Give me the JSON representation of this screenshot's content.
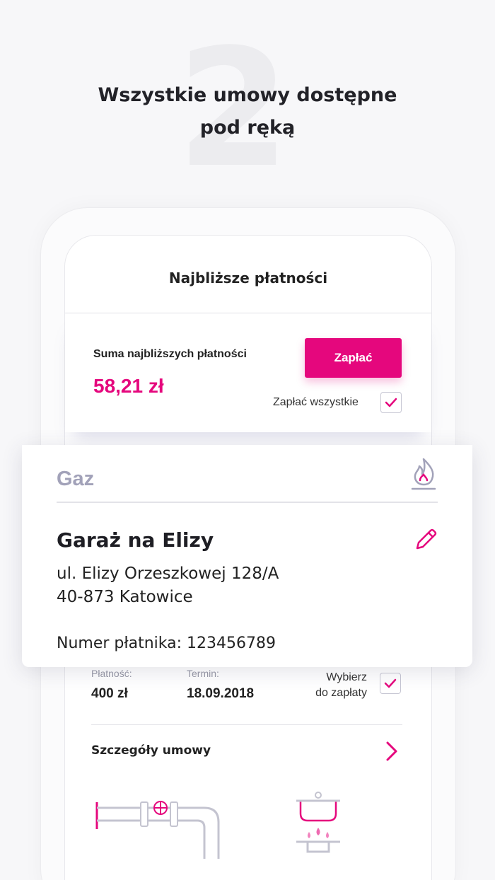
{
  "intro": {
    "step_number": "2",
    "headline_line1": "Wszystkie umowy dostępne",
    "headline_line2": "pod ręką"
  },
  "screen": {
    "title": "Najbliższe płatności"
  },
  "summary": {
    "label": "Suma najbliższych płatności",
    "amount": "58,21 zł",
    "pay_button": "Zapłać",
    "pay_all_label": "Zapłać wszystkie",
    "pay_all_checked": true
  },
  "contract": {
    "type": "Gaz",
    "name": "Garaż na Elizy",
    "address_line1": "ul. Elizy Orzeszkowej 128/A",
    "address_line2": "40-873 Katowice",
    "payer_number": "Numer płatnika: 123456789"
  },
  "payment": {
    "amount_label": "Płatność:",
    "amount": "400 zł",
    "term_label": "Termin:",
    "term": "18.09.2018",
    "choose_line1": "Wybierz",
    "choose_line2": "do zapłaty",
    "choose_checked": true,
    "details_link": "Szczegóły umowy"
  },
  "colors": {
    "accent": "#e5077d",
    "muted_title": "#a2a2b9",
    "background": "#f7f7f9"
  },
  "icons": [
    "flame-icon",
    "pencil-icon",
    "check-icon",
    "chevron-right-icon",
    "pipe-illustration"
  ]
}
